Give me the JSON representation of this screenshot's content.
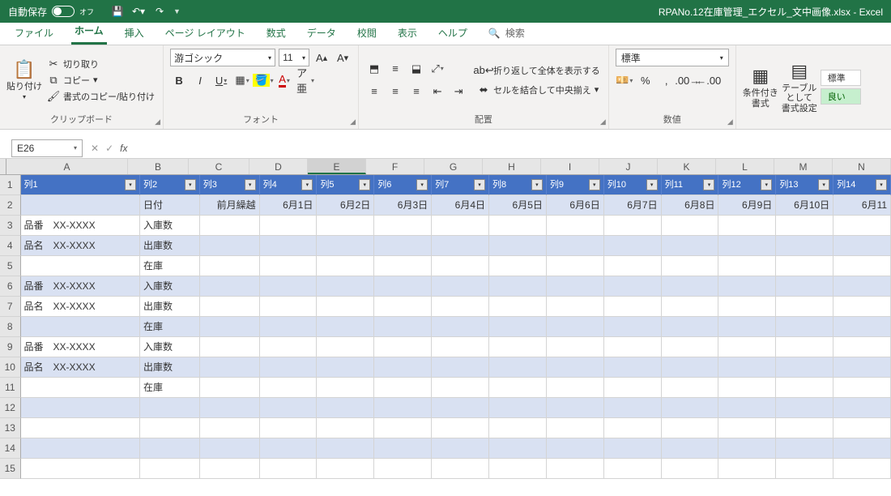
{
  "titlebar": {
    "autosave_label": "自動保存",
    "autosave_state": "オフ",
    "filename": "RPANo.12在庫管理_エクセル_文中画像.xlsx - Excel"
  },
  "tabs": {
    "file": "ファイル",
    "home": "ホーム",
    "insert": "挿入",
    "layout": "ページ レイアウト",
    "formulas": "数式",
    "data": "データ",
    "review": "校閲",
    "view": "表示",
    "help": "ヘルプ",
    "search": "検索"
  },
  "ribbon": {
    "clipboard": {
      "paste": "貼り付け",
      "cut": "切り取り",
      "copy": "コピー",
      "fmtpainter": "書式のコピー/貼り付け",
      "group": "クリップボード"
    },
    "font": {
      "name": "游ゴシック",
      "size": "11",
      "group": "フォント"
    },
    "alignment": {
      "wrap": "折り返して全体を表示する",
      "merge": "セルを結合して中央揃え",
      "group": "配置"
    },
    "number": {
      "format": "標準",
      "group": "数値"
    },
    "styles": {
      "cond": "条件付き\n書式",
      "table": "テーブルとして\n書式設定",
      "normal": "標準",
      "good": "良い"
    }
  },
  "formula_bar": {
    "name_box": "E26"
  },
  "grid": {
    "columns": [
      "A",
      "B",
      "C",
      "D",
      "E",
      "F",
      "G",
      "H",
      "I",
      "J",
      "K",
      "L",
      "M",
      "N"
    ],
    "selected_col": "E",
    "col_widths": [
      "wA",
      "wB",
      "wC",
      "wstd",
      "wstd",
      "wstd",
      "wstd",
      "wstd",
      "wstd",
      "wstd",
      "wstd",
      "wstd",
      "wstd",
      "wstd",
      "wstd"
    ],
    "header_labels": [
      "列1",
      "列2",
      "列3",
      "列4",
      "列5",
      "列6",
      "列7",
      "列8",
      "列9",
      "列10",
      "列11",
      "列12",
      "列13",
      "列14"
    ],
    "rows": [
      {
        "n": 2,
        "band": true,
        "cells": [
          "",
          "日付",
          "前月繰越",
          "6月1日",
          "6月2日",
          "6月3日",
          "6月4日",
          "6月5日",
          "6月6日",
          "6月7日",
          "6月8日",
          "6月9日",
          "6月10日",
          "6月11"
        ]
      },
      {
        "n": 3,
        "band": false,
        "cells": [
          "品番　XX-XXXX",
          "入庫数",
          "",
          "",
          "",
          "",
          "",
          "",
          "",
          "",
          "",
          "",
          "",
          ""
        ]
      },
      {
        "n": 4,
        "band": true,
        "cells": [
          "品名　XX-XXXX",
          "出庫数",
          "",
          "",
          "",
          "",
          "",
          "",
          "",
          "",
          "",
          "",
          "",
          ""
        ]
      },
      {
        "n": 5,
        "band": false,
        "cells": [
          "",
          "在庫",
          "",
          "",
          "",
          "",
          "",
          "",
          "",
          "",
          "",
          "",
          "",
          ""
        ]
      },
      {
        "n": 6,
        "band": true,
        "cells": [
          "品番　XX-XXXX",
          "入庫数",
          "",
          "",
          "",
          "",
          "",
          "",
          "",
          "",
          "",
          "",
          "",
          ""
        ]
      },
      {
        "n": 7,
        "band": false,
        "cells": [
          "品名　XX-XXXX",
          "出庫数",
          "",
          "",
          "",
          "",
          "",
          "",
          "",
          "",
          "",
          "",
          "",
          ""
        ]
      },
      {
        "n": 8,
        "band": true,
        "cells": [
          "",
          "在庫",
          "",
          "",
          "",
          "",
          "",
          "",
          "",
          "",
          "",
          "",
          "",
          ""
        ]
      },
      {
        "n": 9,
        "band": false,
        "cells": [
          "品番　XX-XXXX",
          "入庫数",
          "",
          "",
          "",
          "",
          "",
          "",
          "",
          "",
          "",
          "",
          "",
          ""
        ]
      },
      {
        "n": 10,
        "band": true,
        "cells": [
          "品名　XX-XXXX",
          "出庫数",
          "",
          "",
          "",
          "",
          "",
          "",
          "",
          "",
          "",
          "",
          "",
          ""
        ]
      },
      {
        "n": 11,
        "band": false,
        "cells": [
          "",
          "在庫",
          "",
          "",
          "",
          "",
          "",
          "",
          "",
          "",
          "",
          "",
          "",
          ""
        ]
      },
      {
        "n": 12,
        "band": true,
        "cells": [
          "",
          "",
          "",
          "",
          "",
          "",
          "",
          "",
          "",
          "",
          "",
          "",
          "",
          ""
        ]
      },
      {
        "n": 13,
        "band": false,
        "cells": [
          "",
          "",
          "",
          "",
          "",
          "",
          "",
          "",
          "",
          "",
          "",
          "",
          "",
          ""
        ]
      },
      {
        "n": 14,
        "band": true,
        "cells": [
          "",
          "",
          "",
          "",
          "",
          "",
          "",
          "",
          "",
          "",
          "",
          "",
          "",
          ""
        ]
      },
      {
        "n": 15,
        "band": false,
        "cells": [
          "",
          "",
          "",
          "",
          "",
          "",
          "",
          "",
          "",
          "",
          "",
          "",
          "",
          ""
        ]
      }
    ]
  }
}
